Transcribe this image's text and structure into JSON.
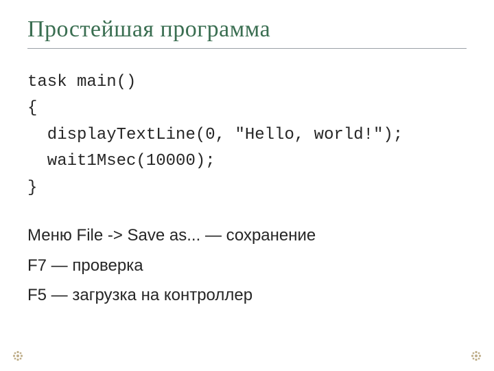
{
  "title": "Простейшая программа",
  "code": {
    "l1": "task main()",
    "l2": "{",
    "l3": "  displayTextLine(0, \"Hello, world!\");",
    "l4": "  wait1Msec(10000);",
    "l5": "}"
  },
  "notes": {
    "n1": "Меню File -> Save as... — сохранение",
    "n2": "F7 — проверка",
    "n3": "F5 — загрузка на контроллер"
  }
}
